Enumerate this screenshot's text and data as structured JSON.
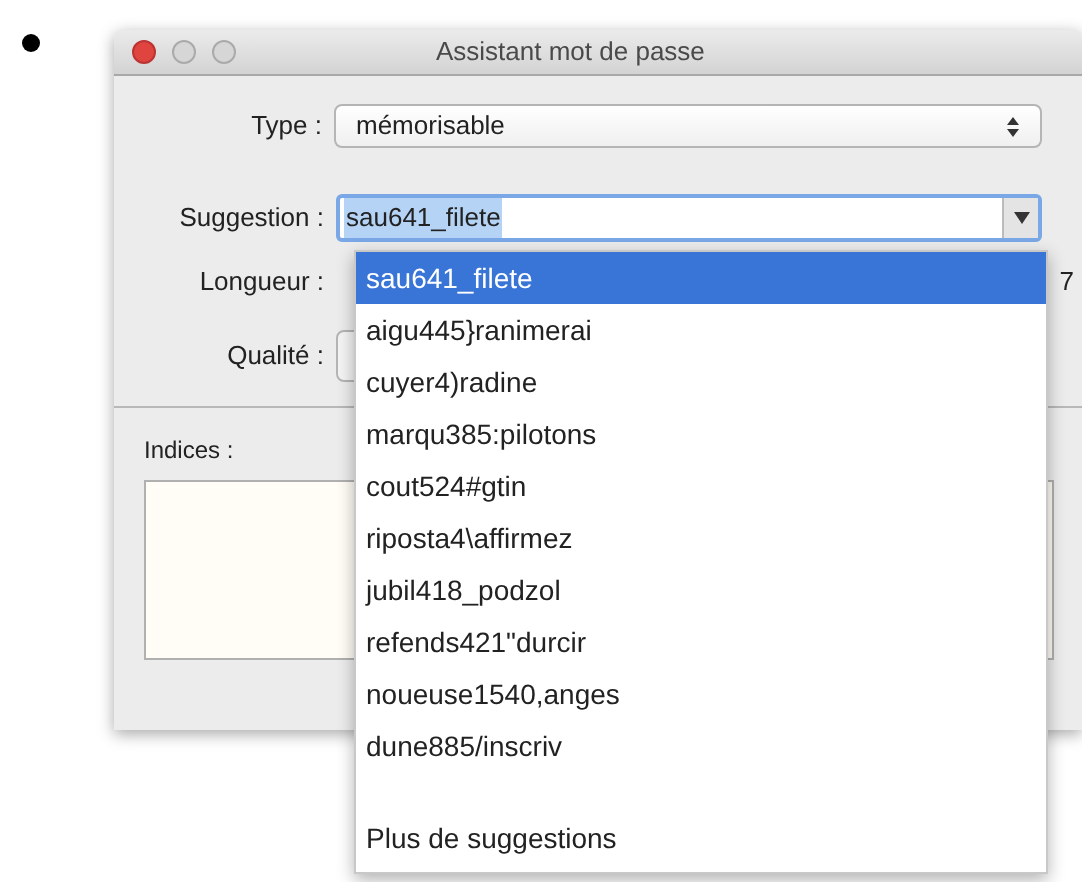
{
  "window": {
    "title": "Assistant mot de passe"
  },
  "type": {
    "label": "Type :",
    "value": "mémorisable"
  },
  "suggestion": {
    "label": "Suggestion :",
    "value": "sau641_filete",
    "options": [
      {
        "text": "sau641_filete",
        "selected": true
      },
      {
        "text": "aigu445}ranimerai",
        "selected": false
      },
      {
        "text": "cuyer4)radine",
        "selected": false
      },
      {
        "text": "marqu385:pilotons",
        "selected": false
      },
      {
        "text": "cout524#gtin",
        "selected": false
      },
      {
        "text": "riposta4\\affirmez",
        "selected": false
      },
      {
        "text": "jubil418_podzol",
        "selected": false
      },
      {
        "text": "refends421\"durcir",
        "selected": false
      },
      {
        "text": "noueuse1540,anges",
        "selected": false
      },
      {
        "text": "dune885/inscriv",
        "selected": false
      }
    ],
    "more": "Plus de suggestions"
  },
  "length": {
    "label": "Longueur :",
    "value": "7"
  },
  "quality": {
    "label": "Qualité :"
  },
  "hints": {
    "label": "Indices :"
  }
}
